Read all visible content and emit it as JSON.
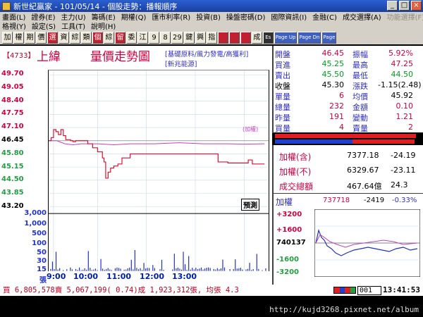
{
  "window": {
    "title": "新世紀贏家 - 101/05/14 - 個股走勢：播報順序"
  },
  "menu": {
    "row1": [
      "畫面(L)",
      "證券(E)",
      "主力(U)",
      "籌碼(E)",
      "期權(Q)",
      "匯市利率(R)",
      "投資(B)",
      "操盤密碼(D)",
      "國際資訊(I)",
      "金融(C)",
      "成交選擇(A)"
    ],
    "row1_disabled": "功能選擇(F)",
    "row2": [
      "格視(Y)",
      "設定(S)",
      "工具(T)",
      "說明(H)"
    ]
  },
  "toolbar": {
    "buttons": [
      "加",
      "權",
      "期",
      "價",
      "選",
      "資",
      "綜",
      "類",
      "個",
      "綜",
      "留",
      "委",
      "江",
      "9",
      "8",
      "29",
      "鍵",
      "興",
      "指",
      "",
      "",
      "",
      "成"
    ],
    "small": [
      "Es",
      "Page Up",
      "Page Dn",
      "Page"
    ]
  },
  "stock": {
    "code": "【4733】",
    "name": "上緯",
    "title": "量價走勢圖",
    "category": "[基礎原料/風力發電/高獲利]",
    "category2": "[新兆能源]"
  },
  "chart_data": {
    "type": "line",
    "x_ticks": [
      "9:00",
      "10:00",
      "11:00",
      "12:00",
      "13:00"
    ],
    "price_ticks": [
      "49.70",
      "49.05",
      "48.40",
      "47.75",
      "47.10",
      "46.45",
      "45.80",
      "45.15",
      "44.50",
      "43.85",
      "43.20"
    ],
    "volume_ticks": [
      "3,000",
      "1,000",
      "500",
      "100",
      "50",
      "30",
      "15",
      "張"
    ],
    "ref_price": 46.45,
    "ylim": [
      43.2,
      49.7
    ],
    "index_label": "(加權)",
    "annotation": "預測",
    "price_series": [
      [
        0,
        46.45
      ],
      [
        3,
        46.6
      ],
      [
        6,
        47.0
      ],
      [
        9,
        46.9
      ],
      [
        12,
        46.75
      ],
      [
        15,
        47.0
      ],
      [
        18,
        46.7
      ],
      [
        21,
        46.5
      ],
      [
        24,
        46.5
      ],
      [
        27,
        46.45
      ],
      [
        30,
        46.4
      ],
      [
        33,
        46.45
      ],
      [
        36,
        46.45
      ],
      [
        45,
        46.45
      ],
      [
        48,
        46.3
      ],
      [
        54,
        46.1
      ],
      [
        60,
        45.9
      ],
      [
        63,
        45.9
      ],
      [
        66,
        45.6
      ],
      [
        68,
        45.4
      ],
      [
        70,
        44.6
      ],
      [
        73,
        44.9
      ],
      [
        76,
        45.1
      ],
      [
        80,
        45.2
      ],
      [
        85,
        45.3
      ],
      [
        90,
        45.6
      ],
      [
        100,
        45.8
      ],
      [
        110,
        45.8
      ],
      [
        120,
        45.8
      ],
      [
        130,
        45.8
      ],
      [
        140,
        45.8
      ],
      [
        145,
        45.8
      ],
      [
        160,
        45.8
      ],
      [
        185,
        45.8
      ],
      [
        200,
        45.8
      ],
      [
        208,
        45.4
      ],
      [
        220,
        45.35
      ],
      [
        240,
        45.35
      ],
      [
        245,
        45.5
      ],
      [
        250,
        45.3
      ],
      [
        265,
        45.3
      ]
    ],
    "index_series": [
      [
        0,
        46.45
      ],
      [
        10,
        46.45
      ],
      [
        20,
        46.3
      ],
      [
        30,
        46.25
      ],
      [
        40,
        46.3
      ],
      [
        60,
        46.3
      ],
      [
        80,
        46.25
      ],
      [
        100,
        46.3
      ],
      [
        130,
        46.3
      ],
      [
        160,
        46.35
      ],
      [
        190,
        46.3
      ],
      [
        220,
        46.3
      ],
      [
        240,
        46.28
      ],
      [
        265,
        46.3
      ]
    ]
  },
  "quote": {
    "rows": [
      {
        "l1": "開盤",
        "v1": "46.45",
        "l2": "振幅",
        "v2": "5.92%",
        "c1": "#d00040",
        "c2": "#d00040"
      },
      {
        "l1": "買進",
        "v1": "45.25",
        "l2": "最高",
        "v2": "47.25",
        "c1": "#00a020",
        "c2": "#d00040"
      },
      {
        "l1": "賣出",
        "v1": "45.50",
        "l2": "最低",
        "v2": "44.50",
        "c1": "#00a020",
        "c2": "#00a020"
      },
      {
        "l1": "收盤",
        "v1": "45.30",
        "l2": "漲跌",
        "v2": "-1.15(2.48)",
        "c1": "#000000",
        "c2": "#000000"
      },
      {
        "l1": "單量",
        "v1": "6",
        "l2": "均價",
        "v2": "45.92",
        "c1": "#d00040",
        "c2": "#000000"
      },
      {
        "l1": "總量",
        "v1": "232",
        "l2": "金額",
        "v2": "0.10",
        "c1": "#d00040",
        "c2": "#d00040"
      },
      {
        "l1": "昨量",
        "v1": "191",
        "l2": "變動",
        "v2": "1.21",
        "c1": "#d00040",
        "c2": "#d00040"
      },
      {
        "l1": "買量",
        "v1": "4",
        "l2": "賣量",
        "v2": "2",
        "c1": "#d00040",
        "c2": "#d00040"
      }
    ]
  },
  "index_panel": {
    "rows": [
      {
        "label": "加權(含)",
        "value": "7377.18",
        "change": "-24.19"
      },
      {
        "label": "加權(不)",
        "value": "6329.67",
        "change": "-23.11"
      },
      {
        "label": "成交總額",
        "value": "467.64億",
        "change": "24.3"
      }
    ]
  },
  "mini": {
    "label": "加權",
    "value": "737718",
    "change": "-2419",
    "pct": "-0.33%",
    "ticks": [
      "+3200",
      "+1600",
      "740137",
      "-1600",
      "-3200"
    ]
  },
  "status": {
    "text": "買 6,805,578賣 5,067,199( 0.74)成 1,923,312張, 均張 4.3",
    "code": "001",
    "time": "13:41:53"
  },
  "watermark": "http://kujd3268.pixnet.net/album",
  "colors": {
    "up": "#d00040",
    "down": "#00a020",
    "index_line": "#c040c0"
  }
}
